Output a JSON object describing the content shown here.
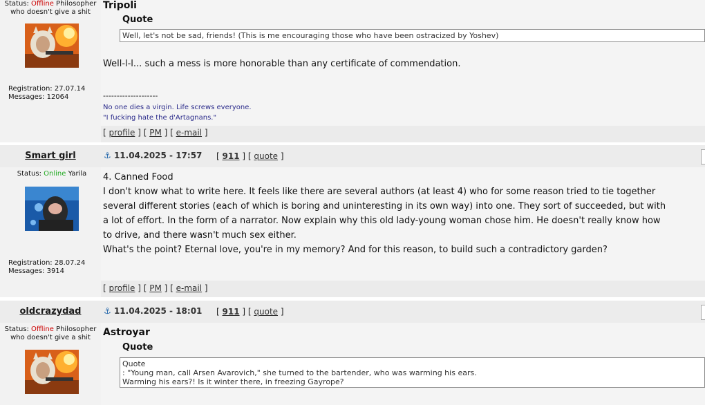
{
  "posts": [
    {
      "username": "",
      "status_label": "Status:",
      "status_state": "Offline",
      "status_text_1": "Philosopher",
      "status_text_2": "who doesn't give a shit",
      "registration": "Registration: 27.07.14",
      "messages": "Messages: 12064",
      "title": "Tripoli",
      "quote_label": "Quote",
      "quote_lines": [
        "Well, let's not be sad, friends! (This is me encouraging those who have been ostracized by Yoshev)"
      ],
      "body": [
        "Well-l-l... such a mess is more honorable than any certificate of commendation."
      ],
      "signature_sep": "--------------------",
      "signature": [
        "No one dies a virgin. Life screws everyone.",
        "\"I fucking hate the d'Artagnans.\""
      ],
      "footer": {
        "profile": "profile",
        "pm": "PM",
        "email": "e-mail"
      }
    },
    {
      "username": "Smart girl",
      "anchor": "⚓",
      "date": "11.04.2025 - 17:57",
      "number": "911",
      "quote_link": "quote",
      "status_label": "Status:",
      "status_state": "Online",
      "status_text_1": "Yarila",
      "registration": "Registration: 28.07.24",
      "messages": "Messages: 3914",
      "title": "4. Canned Food",
      "body": [
        "I don't know what to write here. It feels like there are several authors (at least 4) who for some reason tried to tie together",
        "several different stories (each of which is boring and uninteresting in its own way) into one. They sort of succeeded, but with",
        "a lot of effort. In the form of a narrator. Now explain why this old lady-young woman chose him. He doesn't really know how",
        "to drive, and there wasn't much sex either.",
        "What's the point? Eternal love, you're in my memory? And for this reason, to build such a contradictory garden?"
      ],
      "footer": {
        "profile": "profile",
        "pm": "PM",
        "email": "e-mail"
      }
    },
    {
      "username": "oldcrazydad",
      "anchor": "⚓",
      "date": "11.04.2025 - 18:01",
      "number": "911",
      "quote_link": "quote",
      "status_label": "Status:",
      "status_state": "Offline",
      "status_text_1": "Philosopher",
      "status_text_2": "who doesn't give a shit",
      "title": "Astroyar",
      "quote_label": "Quote",
      "quote_lines": [
        "Quote",
        ": \"Young man, call Arsen Avarovich,\" she turned to the bartender, who was warming his ears.",
        "Warming his ears?! Is it winter there, in freezing Gayrope?"
      ]
    }
  ],
  "colors": {
    "offline": "#cc0000",
    "online": "#22aa22",
    "post_number": "#cc0000",
    "anchor": "#2266aa",
    "signature": "#2a2a8a"
  }
}
